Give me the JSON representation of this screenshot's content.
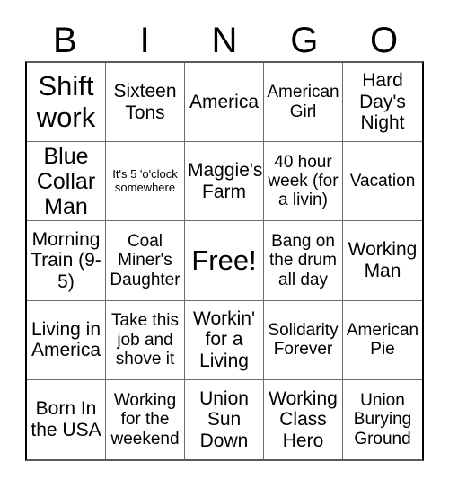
{
  "header": {
    "letters": [
      "B",
      "I",
      "N",
      "G",
      "O"
    ]
  },
  "grid": {
    "rows": 5,
    "columns": 5,
    "cells": [
      {
        "text": "Shift work",
        "size": "fs-xxl"
      },
      {
        "text": "Sixteen Tons",
        "size": "fs-lg"
      },
      {
        "text": "America",
        "size": "fs-lg"
      },
      {
        "text": "American Girl",
        "size": "fs-md"
      },
      {
        "text": "Hard Day's Night",
        "size": "fs-lg"
      },
      {
        "text": "Blue Collar Man",
        "size": "fs-xl"
      },
      {
        "text": "It's 5 'o'clock somewhere",
        "size": "fs-xs"
      },
      {
        "text": "Maggie's Farm",
        "size": "fs-lg"
      },
      {
        "text": "40 hour week (for a livin)",
        "size": "fs-md"
      },
      {
        "text": "Vacation",
        "size": "fs-md"
      },
      {
        "text": "Morning Train (9-5)",
        "size": "fs-lg"
      },
      {
        "text": "Coal Miner's Daughter",
        "size": "fs-md"
      },
      {
        "text": "Free!",
        "size": "fs-xxl"
      },
      {
        "text": "Bang on the drum all day",
        "size": "fs-md"
      },
      {
        "text": "Working Man",
        "size": "fs-lg"
      },
      {
        "text": "Living in America",
        "size": "fs-lg"
      },
      {
        "text": "Take this job and shove it",
        "size": "fs-md"
      },
      {
        "text": "Workin' for a Living",
        "size": "fs-lg"
      },
      {
        "text": "Solidarity Forever",
        "size": "fs-md"
      },
      {
        "text": "American Pie",
        "size": "fs-md"
      },
      {
        "text": "Born In the USA",
        "size": "fs-lg"
      },
      {
        "text": "Working for the weekend",
        "size": "fs-md"
      },
      {
        "text": "Union Sun Down",
        "size": "fs-lg"
      },
      {
        "text": "Working Class Hero",
        "size": "fs-lg"
      },
      {
        "text": "Union Burying Ground",
        "size": "fs-md"
      }
    ],
    "free_space_index": 12
  },
  "colors": {
    "background": "#ffffff",
    "text": "#000000",
    "grid_line": "#6b6b6b",
    "grid_border": "#000000"
  }
}
